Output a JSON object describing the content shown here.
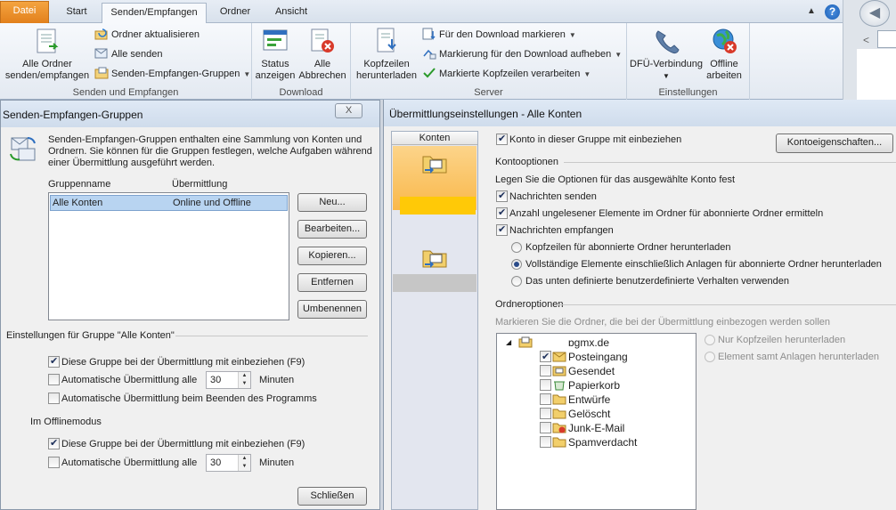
{
  "ribbon": {
    "tabs": [
      "Datei",
      "Start",
      "Senden/Empfangen",
      "Ordner",
      "Ansicht"
    ],
    "active_tab": "Senden/Empfangen",
    "groups": {
      "send_receive": {
        "label": "Senden und Empfangen",
        "big_button": "Alle Ordner\nsenden/empfangen",
        "small": [
          "Ordner aktualisieren",
          "Alle senden",
          "Senden-Empfangen-Gruppen"
        ]
      },
      "download": {
        "label": "Download",
        "buttons": [
          "Status\nanzeigen",
          "Alle\nAbbrechen"
        ]
      },
      "server": {
        "label": "Server",
        "big_button": "Kopfzeilen\nherunterladen",
        "small": [
          "Für den Download markieren",
          "Markierung für den Download aufheben",
          "Markierte Kopfzeilen verarbeiten"
        ]
      },
      "settings": {
        "label": "Einstellungen",
        "buttons": [
          "DFÜ-Verbindung",
          "Offline\narbeiten"
        ]
      }
    }
  },
  "left_dialog": {
    "title": "Senden-Empfangen-Gruppen",
    "close_label": "X",
    "description": "Senden-Empfangen-Gruppen enthalten eine Sammlung von Konten und Ordnern. Sie können für die Gruppen festlegen, welche Aufgaben während einer Übermittlung ausgeführt werden.",
    "desc_lines": [
      "Senden-Empfangen-Gruppen enthalten eine Sammlung von Konten und",
      "Ordnern. Sie können für die Gruppen festlegen, welche Aufgaben während",
      "einer Übermittlung ausgeführt werden."
    ],
    "col_group": "Gruppenname",
    "col_transfer": "Übermittlung",
    "rows": [
      {
        "name": "Alle Konten",
        "transfer": "Online und Offline"
      }
    ],
    "buttons": [
      "Neu...",
      "Bearbeiten...",
      "Kopieren...",
      "Entfernen",
      "Umbenennen"
    ],
    "settings_header": "Einstellungen für Gruppe \"Alle Konten\"",
    "online": {
      "include": "Diese Gruppe bei der Übermittlung mit einbeziehen (F9)",
      "auto_every": "Automatische Übermittlung alle",
      "minutes_value": "30",
      "minutes": "Minuten",
      "on_exit": "Automatische Übermittlung beim Beenden des Programms"
    },
    "offline_header": "Im Offlinemodus",
    "offline": {
      "include": "Diese Gruppe bei der Übermittlung mit einbeziehen (F9)",
      "auto_every": "Automatische Übermittlung alle",
      "minutes_value": "30",
      "minutes": "Minuten"
    },
    "close_button": "Schließen"
  },
  "right_dialog": {
    "title": "Übermittlungseinstellungen - Alle Konten",
    "konten": "Konten",
    "include_account": "Konto in dieser Gruppe mit einbeziehen",
    "account_props": "Kontoeigenschaften...",
    "account_options": "Kontooptionen",
    "options_hint": "Legen Sie die Optionen für das ausgewählte Konto fest",
    "send_mail": "Nachrichten senden",
    "unread_count": "Anzahl ungelesener Elemente im Ordner für abonnierte Ordner ermitteln",
    "receive_mail": "Nachrichten empfangen",
    "radio_headers": "Kopfzeilen für abonnierte Ordner herunterladen",
    "radio_full": "Vollständige Elemente einschließlich Anlagen für abonnierte Ordner herunterladen",
    "radio_custom": "Das unten definierte benutzerdefinierte Verhalten verwenden",
    "folder_options": "Ordneroptionen",
    "folder_hint": "Markieren Sie die Ordner, die bei der Übermittlung einbezogen werden sollen",
    "folder_radio_headers": "Nur Kopfzeilen herunterladen",
    "folder_radio_full": "Element samt Anlagen herunterladen",
    "tree_root": "ɒgmx.de",
    "folders": [
      "Posteingang",
      "Gesendet",
      "Papierkorb",
      "Entwürfe",
      "Gelöscht",
      "Junk-E-Mail",
      "Spamverdacht"
    ]
  },
  "colors": {
    "file_tab": "#e2801c",
    "selected_account": "#f9b84b",
    "selection_row": "#b8d4f1"
  }
}
